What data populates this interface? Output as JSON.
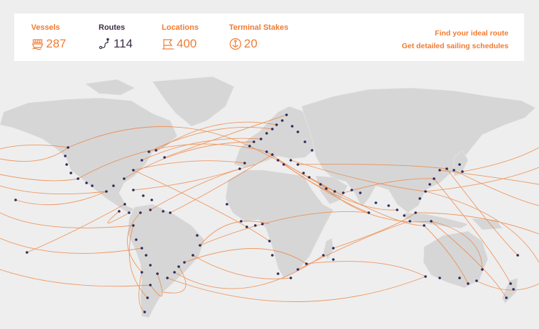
{
  "stats": [
    {
      "key": "vessels",
      "label": "Vessels",
      "value": "287",
      "icon": "ship-icon",
      "color": "#f07b33"
    },
    {
      "key": "routes",
      "label": "Routes",
      "value": "114",
      "icon": "route-icon",
      "color": "#3d2f4a"
    },
    {
      "key": "locations",
      "label": "Locations",
      "value": "400",
      "icon": "map-flag-icon",
      "color": "#f07b33"
    },
    {
      "key": "terminals",
      "label": "Terminal Stakes",
      "value": "20",
      "icon": "anchor-icon",
      "color": "#f07b33"
    }
  ],
  "links": {
    "find_route": "Find your ideal route",
    "schedules": "Get detailed sailing schedules"
  },
  "colors": {
    "accent": "#f07b33",
    "port_dot": "#2f2a5c",
    "land": "#d6d6d6",
    "ocean": "#eeeeee"
  }
}
